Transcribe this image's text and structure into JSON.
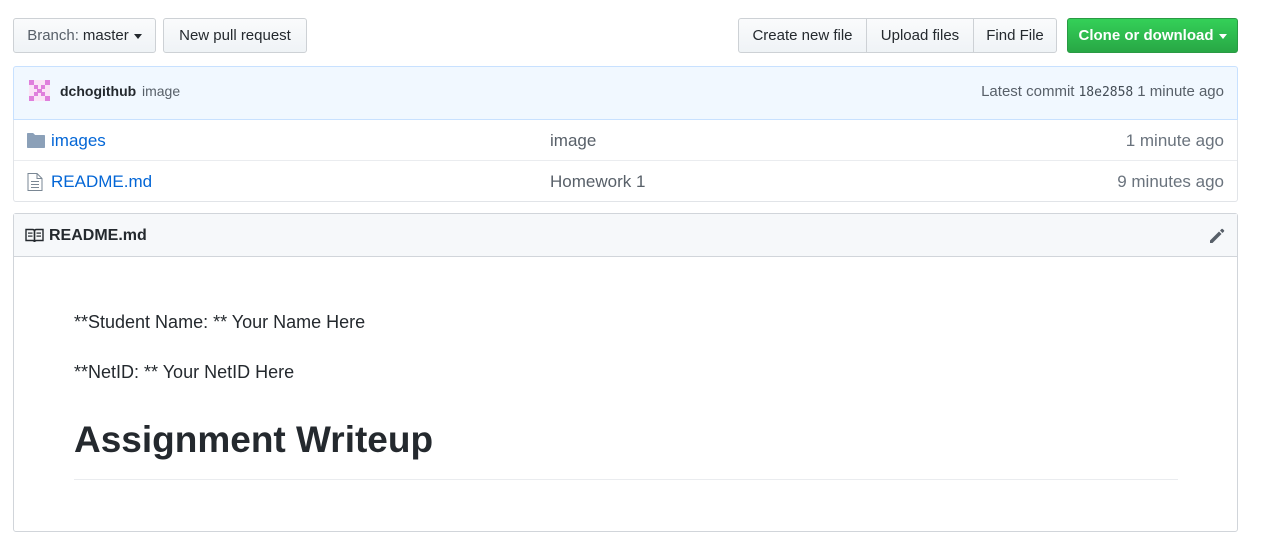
{
  "toolbar": {
    "branch_prefix": "Branch:",
    "branch_name": "master",
    "new_pull_request": "New pull request",
    "create_new_file": "Create new file",
    "upload_files": "Upload files",
    "find_file": "Find File",
    "clone_or_download": "Clone or download"
  },
  "commit": {
    "user": "dchogithub",
    "message": "image",
    "latest_commit_label": "Latest commit",
    "sha": "18e2858",
    "age": "1 minute ago"
  },
  "files": [
    {
      "icon": "folder-icon",
      "name": "images",
      "message": "image",
      "age": "1 minute ago"
    },
    {
      "icon": "file-icon",
      "name": "README.md",
      "message": "Homework 1",
      "age": "9 minutes ago"
    }
  ],
  "readme": {
    "title": "README.md",
    "icon": "book-icon",
    "paragraphs": [
      "**Student Name: ** Your Name Here",
      "**NetID: ** Your NetID Here"
    ],
    "heading": "Assignment Writeup"
  },
  "colors": {
    "link": "#0366d6",
    "clone_button": "#28a745",
    "commit_bar_bg": "#f1f8ff"
  }
}
